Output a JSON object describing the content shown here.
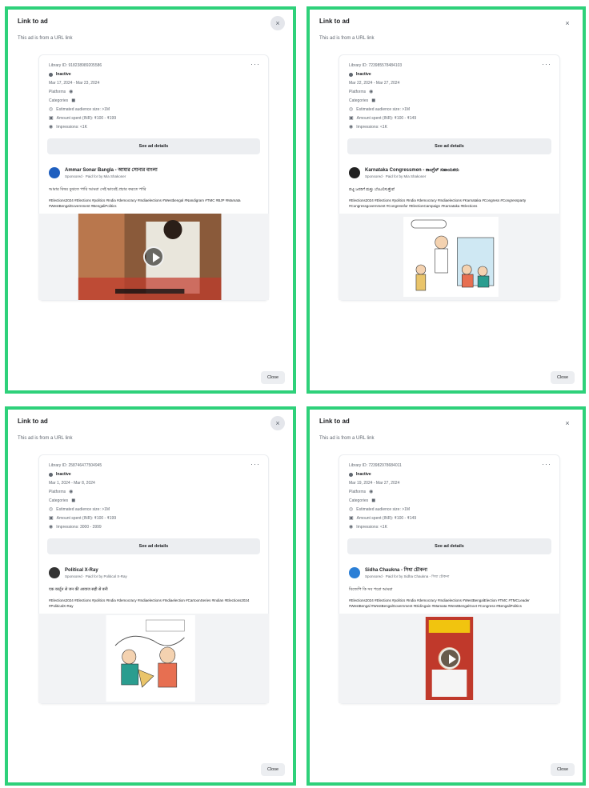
{
  "panels": [
    {
      "title": "Link to ad",
      "subtitle": "This ad is from a URL link",
      "close_icon": "×",
      "library_id": "Library ID: 918238989205586",
      "status": "Inactive",
      "dates": "Mar 17, 2024 - Mar 23, 2024",
      "platforms_label": "Platforms",
      "categories_label": "Categories",
      "audience": "Estimated audience size: >1M",
      "spent": "Amount spent (INR): ₹100 - ₹199",
      "impressions": "Impressions: <1K",
      "details_label": "See ad details",
      "advertiser_name": "Ammar Sonar Bangla - আমার সোনার বাংলা",
      "sponsored": "Sponsored · Paid for by Mia Shakoner",
      "body_text": "আমার বিষয় বুঝতে পারি আমরা সেই ভাবেই প্রচার করতে পারি",
      "hashtags": "#Elections2024 #Elections #politics #India #democracy #Indiaelections #Westbengal #Nandigram #TMC #BJP #Mamata #WestBengalGovernment #BengaliPolitics",
      "close_label": "Close"
    },
    {
      "title": "Link to ad",
      "subtitle": "This ad is from a URL link",
      "close_icon": "×",
      "library_id": "Library ID: 723985578484103",
      "status": "Inactive",
      "dates": "Mar 22, 2024 - Mar 27, 2024",
      "platforms_label": "Platforms",
      "categories_label": "Categories",
      "audience": "Estimated audience size: >1M",
      "spent": "Amount spent (INR): ₹100 - ₹149",
      "impressions": "Impressions: <1K",
      "details_label": "See ad details",
      "advertiser_name": "Karnataka Congressmen - ಕಾಂಗ್ರೆಸ್ ಸಹಾಯಕರು",
      "sponsored": "Sponsored · Paid for by Mia Shakoner",
      "body_text": "ಪಟ್ಟಿ ಜನರಿಗೆ ಮತ್ತು ಬೆಂಬಲಿಸುತ್ತೇವೆ",
      "hashtags": "#Elections2024 #Elections #politics #India #democracy #Indiaelections #Karnataka #Congress #Congressparty #Congressgovernment #Congressfor #ElectionCampaign #Karnataka #Elections",
      "close_label": "Close"
    },
    {
      "title": "Link to ad",
      "subtitle": "This ad is from a URL link",
      "close_icon": "×",
      "library_id": "Library ID: 258746477504945",
      "status": "Inactive",
      "dates": "Mar 1, 2024 - Mar 8, 2024",
      "platforms_label": "Platforms",
      "categories_label": "Categories",
      "audience": "Estimated audience size: >1M",
      "spent": "Amount spent (INR): ₹100 - ₹199",
      "impressions": "Impressions: 3000 - 3999",
      "details_label": "See ad details",
      "advertiser_name": "Political X-Ray",
      "sponsored": "Sponsored · Paid for by Political X-Ray",
      "body_text": "एक कार्टून से जन की आवाज सही से बनी",
      "hashtags": "#Elections2024 #Elections #politics #India #democracy #Indiaelections #Indiaelection #CartoonSeries #Indian #Elections2024 #PoliticalX-Ray",
      "close_label": "Close"
    },
    {
      "title": "Link to ad",
      "subtitle": "This ad is from a URL link",
      "close_icon": "×",
      "library_id": "Library ID: 723982978684011",
      "status": "Inactive",
      "dates": "Mar 19, 2024 - Mar 27, 2024",
      "platforms_label": "Platforms",
      "categories_label": "Categories",
      "audience": "Estimated audience size: >1M",
      "spent": "Amount spent (INR): ₹100 - ₹149",
      "impressions": "Impressions: <1K",
      "details_label": "See ad details",
      "advertiser_name": "Sidha Chaukna - সিধা চৌকনা",
      "sponsored": "Sponsored · Paid for by Sidha Chaukna - সিধা চৌকনা",
      "body_text": "বিজেপি কি সব পরো আমরা",
      "hashtags": "#Elections2024 #Elections #politics #India #democracy #Indiaelections #WestBengalElection #TMC #TMCLeader #WestBengal #WestBengalGovernment #DidiAgain #Mamata #WestBengalGovt #Congress #BengaliPolitics",
      "close_label": "Close"
    }
  ],
  "colors": {
    "panel_border": "#2ed17a",
    "button_bg": "#eceef1",
    "avatar": "#1f5fbf"
  },
  "icons": {
    "close": "close-icon",
    "more": "more-options-icon",
    "status": "status-dot-icon",
    "platforms": "platform-icon",
    "audience": "audience-icon",
    "spent": "money-icon",
    "impressions": "impressions-icon",
    "play": "play-icon"
  }
}
